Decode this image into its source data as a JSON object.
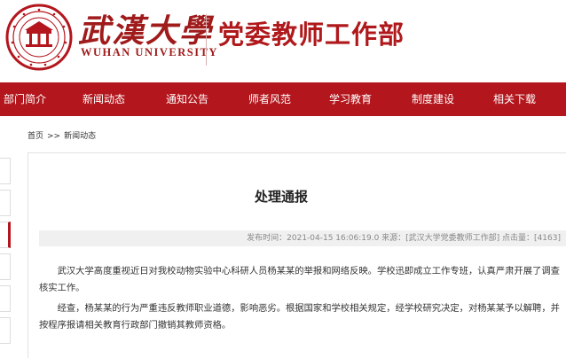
{
  "header": {
    "university_name_zh": "武漢大學",
    "university_name_en": "WUHAN UNIVERSITY",
    "department": "党委教师工作部",
    "brand_color": "#b3161c"
  },
  "nav": {
    "items": [
      {
        "label": "部门简介"
      },
      {
        "label": "新闻动态"
      },
      {
        "label": "通知公告"
      },
      {
        "label": "师者风范"
      },
      {
        "label": "学习教育"
      },
      {
        "label": "制度建设"
      },
      {
        "label": "相关下载"
      }
    ]
  },
  "breadcrumb": {
    "home": "首页",
    "separator": ">>",
    "current": "新闻动态"
  },
  "article": {
    "title": "处理通报",
    "meta": "发布时间：2021-04-15 16:06:19.0 来源：[武汉大学党委教师工作部] 点击量：[4163]",
    "paragraphs": [
      "武汉大学高度重视近日对我校动物实验中心科研人员杨某某的举报和网络反映。学校迅即成立工作专班，认真严肃开展了调查核实工作。",
      "经查，杨某某的行为严重违反教师职业道德，影响恶劣。根据国家和学校相关规定，经学校研究决定，对杨某某予以解聘，并按程序报请相关教育行政部门撤销其教师资格。"
    ]
  }
}
